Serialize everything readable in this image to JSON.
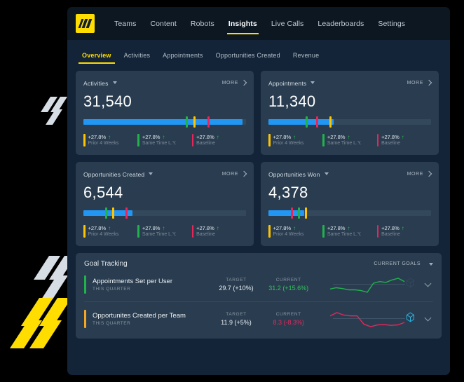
{
  "brand": {
    "logo_icon": "slash-logo-icon",
    "accent_yellow": "#ffdd00",
    "blue": "#2196f3",
    "green": "#21b24b",
    "pink": "#e8265a",
    "cyan": "#29b6e8"
  },
  "topnav": {
    "items": [
      {
        "label": "Teams",
        "active": false
      },
      {
        "label": "Content",
        "active": false
      },
      {
        "label": "Robots",
        "active": false
      },
      {
        "label": "Insights",
        "active": true
      },
      {
        "label": "Live Calls",
        "active": false
      },
      {
        "label": "Leaderboards",
        "active": false
      },
      {
        "label": "Settings",
        "active": false
      }
    ]
  },
  "subnav": {
    "items": [
      {
        "label": "Overview",
        "active": true
      },
      {
        "label": "Activities",
        "active": false
      },
      {
        "label": "Appointments",
        "active": false
      },
      {
        "label": "Opportunities Created",
        "active": false
      },
      {
        "label": "Revenue",
        "active": false
      }
    ]
  },
  "more_label": "MORE",
  "cards": [
    {
      "title": "Activities",
      "value": "31,540",
      "fill_pct": 98,
      "markers": [
        {
          "pos_pct": 63,
          "color": "#21b24b"
        },
        {
          "pos_pct": 67.5,
          "color": "#ffc400"
        },
        {
          "pos_pct": 76.5,
          "color": "#e8265a"
        }
      ],
      "legend": [
        {
          "delta": "+27.8%",
          "trend": "up",
          "label": "Prior 4 Weeks",
          "color": "#ffc400"
        },
        {
          "delta": "+27.8%",
          "trend": "up",
          "label": "Same Time L.Y.",
          "color": "#21b24b"
        },
        {
          "delta": "+27.8%",
          "trend": "up",
          "label": "Baseline",
          "color": "#e8265a"
        }
      ]
    },
    {
      "title": "Appointments",
      "value": "11,340",
      "fill_pct": 40,
      "markers": [
        {
          "pos_pct": 23,
          "color": "#21b24b"
        },
        {
          "pos_pct": 29.5,
          "color": "#e8265a"
        },
        {
          "pos_pct": 37.5,
          "color": "#ffc400"
        }
      ],
      "legend": [
        {
          "delta": "+27.8%",
          "trend": "up",
          "label": "Prior 4 Weeks",
          "color": "#ffc400"
        },
        {
          "delta": "+27.8%",
          "trend": "up",
          "label": "Same Time L.Y.",
          "color": "#21b24b"
        },
        {
          "delta": "+27.8%",
          "trend": "up",
          "label": "Baseline",
          "color": "#e8265a"
        }
      ]
    },
    {
      "title": "Opportunities Created",
      "value": "6,544",
      "fill_pct": 30,
      "markers": [
        {
          "pos_pct": 13.5,
          "color": "#21b24b"
        },
        {
          "pos_pct": 17.5,
          "color": "#ffc400"
        },
        {
          "pos_pct": 26,
          "color": "#e8265a"
        }
      ],
      "legend": [
        {
          "delta": "+27.8%",
          "trend": "up",
          "label": "Prior 4 Weeks",
          "color": "#ffc400"
        },
        {
          "delta": "+27.8%",
          "trend": "up",
          "label": "Same Time L.Y.",
          "color": "#21b24b"
        },
        {
          "delta": "+27.8%",
          "trend": "up",
          "label": "Baseline",
          "color": "#e8265a"
        }
      ]
    },
    {
      "title": "Opportunities Won",
      "value": "4,378",
      "fill_pct": 22,
      "markers": [
        {
          "pos_pct": 14,
          "color": "#e8265a"
        },
        {
          "pos_pct": 18,
          "color": "#21b24b"
        },
        {
          "pos_pct": 22.5,
          "color": "#ffc400"
        }
      ],
      "legend": [
        {
          "delta": "+27.8%",
          "trend": "up",
          "label": "Prior 4 Weeks",
          "color": "#ffc400"
        },
        {
          "delta": "+27.8%",
          "trend": "up",
          "label": "Same Time L.Y.",
          "color": "#21b24b"
        },
        {
          "delta": "+27.8%",
          "trend": "up",
          "label": "Baseline",
          "color": "#e8265a"
        }
      ]
    }
  ],
  "goal_tracking": {
    "title": "Goal Tracking",
    "filter_label": "CURRENT GOALS",
    "columns": {
      "target": "TARGET",
      "current": "CURRENT"
    },
    "rows": [
      {
        "name": "Appointments Set per User",
        "period": "THIS QUARTER",
        "target": "29.7 (+10%)",
        "current": "31.2 (+15.6%)",
        "current_color": "#2fc55a",
        "accent": "#21b24b",
        "sparkline_color": "#21b24b",
        "sparkline": [
          30,
          33,
          31,
          28,
          28,
          26,
          22,
          44,
          48,
          46,
          52,
          56,
          48
        ],
        "badge_icon": "gem-icon",
        "badge_active": false,
        "expand_icon": "chevron-down-icon"
      },
      {
        "name": "Opportunites Created per Team",
        "period": "THIS QUARTER",
        "target": "11.9 (+5%)",
        "current": "8.3 (-8.3%)",
        "current_color": "#e8265a",
        "accent": "#f5a623",
        "sparkline_color": "#e8265a",
        "sparkline": [
          48,
          56,
          50,
          48,
          48,
          28,
          22,
          26,
          27,
          25,
          26,
          32
        ],
        "badge_icon": "gem-icon",
        "badge_active": true,
        "expand_icon": "chevron-down-icon"
      }
    ]
  }
}
